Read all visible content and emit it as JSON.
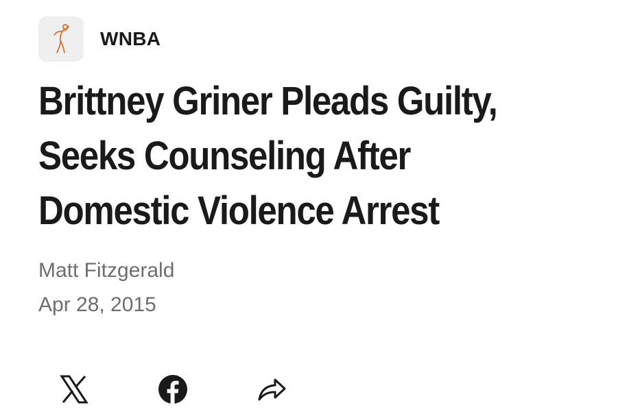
{
  "league": {
    "name": "WNBA",
    "logo_icon": "wnba-logo-icon",
    "logo_color": "#e0651f"
  },
  "article": {
    "headline": "Brittney Griner Pleads Guilty, Seeks Counseling After Domestic Violence Arrest",
    "author": "Matt Fitzgerald",
    "date": "Apr 28, 2015"
  },
  "share": {
    "buttons": [
      {
        "icon": "x-icon"
      },
      {
        "icon": "facebook-icon"
      },
      {
        "icon": "share-arrow-icon"
      }
    ]
  }
}
